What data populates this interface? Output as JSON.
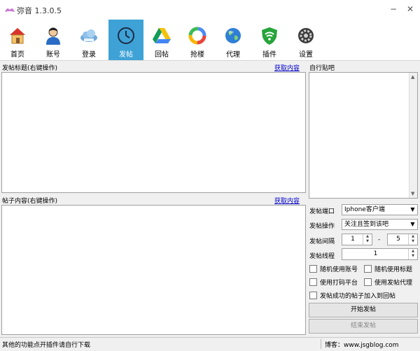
{
  "window": {
    "title": "弥音 1.3.0.5",
    "minimize": "−",
    "close": "✕"
  },
  "toolbar": [
    {
      "label": "首页",
      "icon": "home-icon"
    },
    {
      "label": "账号",
      "icon": "user-icon"
    },
    {
      "label": "登录",
      "icon": "cloud-icon"
    },
    {
      "label": "发帖",
      "icon": "clock-icon",
      "active": true
    },
    {
      "label": "回帖",
      "icon": "drive-icon"
    },
    {
      "label": "抢楼",
      "icon": "ring-icon"
    },
    {
      "label": "代理",
      "icon": "globe-icon"
    },
    {
      "label": "插件",
      "icon": "wifi-shield-icon"
    },
    {
      "label": "设置",
      "icon": "gear-icon"
    }
  ],
  "post_title": {
    "label": "发帖标题(右键操作)",
    "link": "获取内容"
  },
  "post_content": {
    "label": "帖子内容(右键操作)",
    "link": "获取内容"
  },
  "custom_bar": {
    "label": "自行贴吧"
  },
  "form": {
    "port_label": "发帖端口",
    "port_value": "Iphone客户端",
    "action_label": "发帖操作",
    "action_value": "关注且签到该吧",
    "interval_label": "发帖间隔",
    "interval_min": "1",
    "interval_sep": "-",
    "interval_max": "5",
    "threads_label": "发帖线程",
    "threads_value": "1",
    "cb_random_account": "随机使用账号",
    "cb_random_title": "随机使用标题",
    "cb_captcha": "使用打码平台",
    "cb_proxy": "使用发帖代理",
    "cb_add_reply": "发帖成功的帖子加入到回帖",
    "start_button": "开始发帖",
    "stop_button": "结束发帖"
  },
  "status": {
    "left": "其他的功能点开插件请自行下载",
    "right": "博客：www.jsgblog.com"
  },
  "colors": {
    "accent": "#3ea2d6"
  }
}
